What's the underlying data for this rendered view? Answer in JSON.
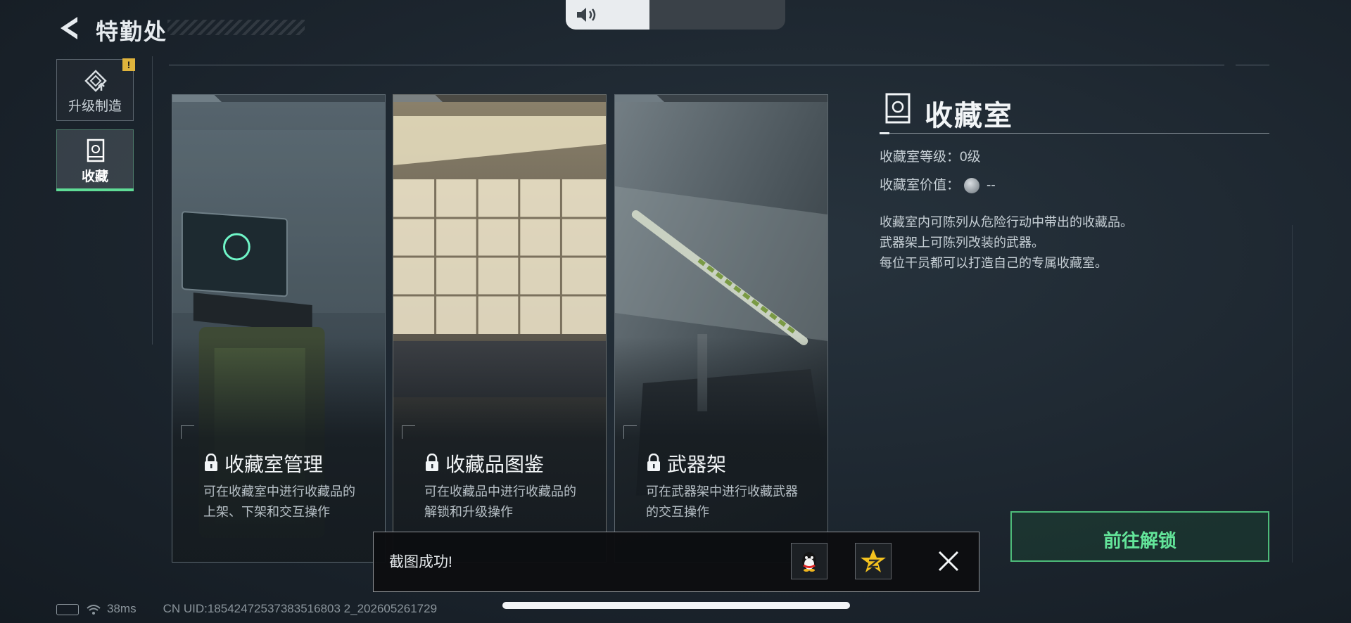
{
  "header": {
    "title": "特勤处"
  },
  "volume": {
    "level": 0.38
  },
  "sidebar": {
    "items": [
      {
        "label": "升级制造",
        "icon": "upgrade-icon",
        "alert": "!"
      },
      {
        "label": "收藏",
        "icon": "collection-room-icon",
        "selected": true
      }
    ]
  },
  "cards": [
    {
      "title": "收藏室管理",
      "desc_line1": "可在收藏室中进行收藏品的",
      "desc_line2": "上架、下架和交互操作",
      "locked": true,
      "icon": "lock-icon"
    },
    {
      "title": "收藏品图鉴",
      "desc_line1": "可在收藏品中进行收藏品的",
      "desc_line2": "解锁和升级操作",
      "locked": true,
      "icon": "lock-icon"
    },
    {
      "title": "武器架",
      "desc_line1": "可在武器架中进行收藏武器",
      "desc_line2": "的交互操作",
      "locked": true,
      "icon": "lock-icon"
    }
  ],
  "panel": {
    "title": "收藏室",
    "level_label": "收藏室等级：",
    "level_value": "0级",
    "value_label": "收藏室价值：",
    "value_value": "--",
    "desc_line1": "收藏室内可陈列从危险行动中带出的收藏品。",
    "desc_line2": "武器架上可陈列改装的武器。",
    "desc_line3": "每位干员都可以打造自己的专属收藏室。",
    "unlock_button": "前往解锁"
  },
  "toast": {
    "message": "截图成功!",
    "share_targets": [
      "qq-icon",
      "qzone-icon"
    ],
    "close_icon": "close-icon"
  },
  "status": {
    "ping": "38ms",
    "uid": "CN UID:18542472537383516803 2_202605261729"
  },
  "colors": {
    "accent_green": "#63e59a",
    "alert_yellow": "#e0b43c",
    "background": "#1c252e"
  }
}
